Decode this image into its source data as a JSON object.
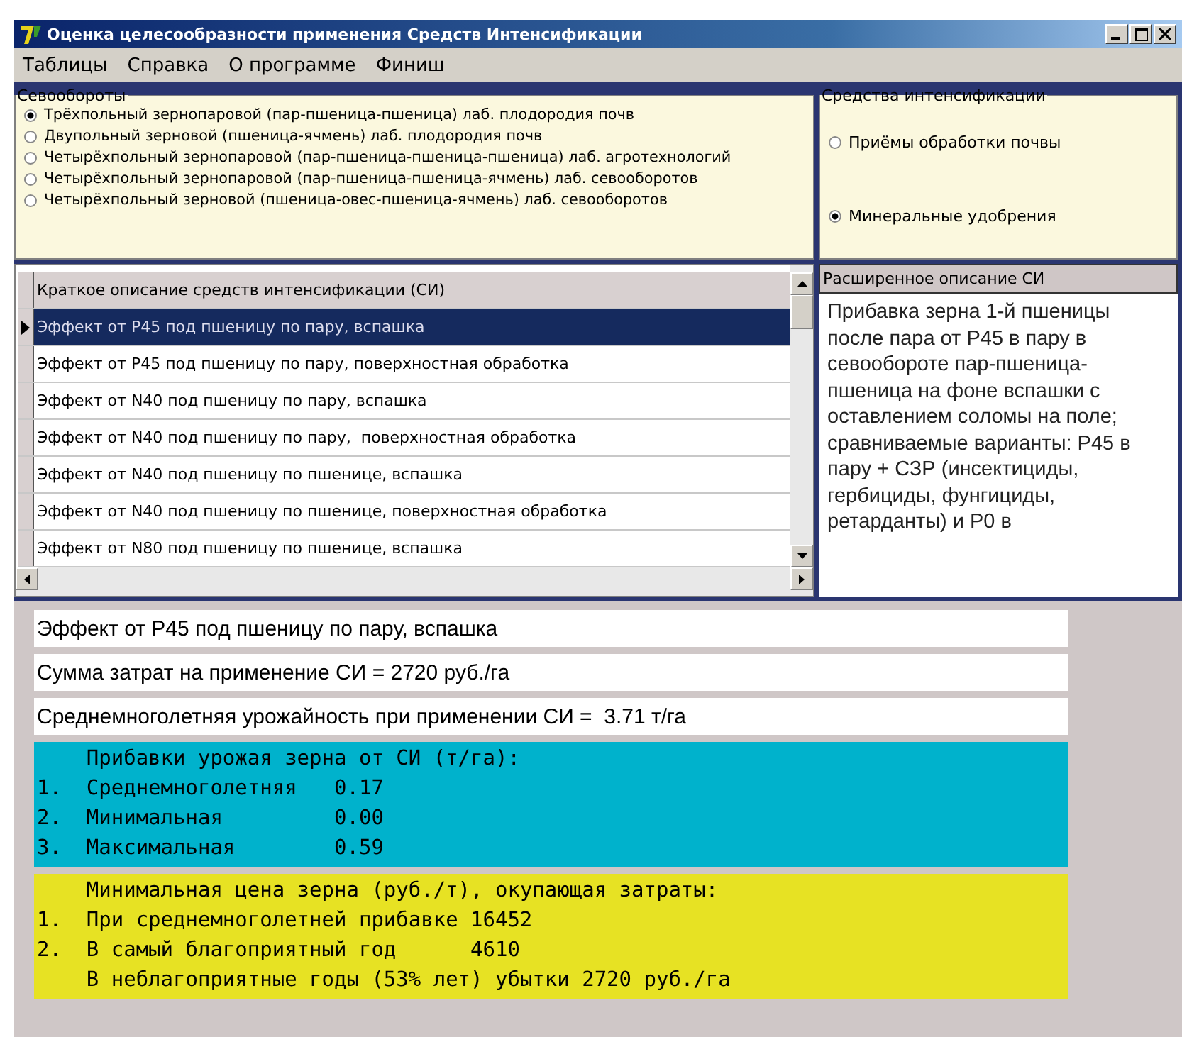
{
  "window": {
    "title": "Оценка целесообразности применения Средств Интенсификации"
  },
  "menu": [
    "Таблицы",
    "Справка",
    "О программе",
    "Финиш"
  ],
  "rotations": {
    "title": "Севообороты",
    "options": [
      {
        "label": "Трёхпольный зернопаровой (пар-пшеница-пшеница) лаб. плодородия почв",
        "selected": true
      },
      {
        "label": "Двупольный зерновой (пшеница-ячмень) лаб. плодородия почв",
        "selected": false
      },
      {
        "label": "Четырёхпольный зернопаровой (пар-пшеница-пшеница-пшеница) лаб. агротехнологий",
        "selected": false
      },
      {
        "label": "Четырёхпольный зернопаровой (пар-пшеница-пшеница-ячмень) лаб. севооборотов",
        "selected": false
      },
      {
        "label": "Четырёхпольный зерновой (пшеница-овес-пшеница-ячмень) лаб. севооборотов",
        "selected": false
      }
    ]
  },
  "means": {
    "title": "Средства интенсификации",
    "options": [
      {
        "label": "Приёмы обработки почвы",
        "selected": false
      },
      {
        "label": "Минеральные удобрения",
        "selected": true
      }
    ]
  },
  "table": {
    "columns": [
      "Краткое описание средств интенсификации (СИ)"
    ],
    "rows": [
      {
        "text": "Эффект от P45 под пшеницу по пару, вспашка",
        "selected": true
      },
      {
        "text": "Эффект от P45 под пшеницу по пару, поверхностная обработка",
        "selected": false
      },
      {
        "text": "Эффект от N40 под пшеницу по пару, вспашка",
        "selected": false
      },
      {
        "text": "Эффект от N40 под пшеницу по пару,  поверхностная обработка",
        "selected": false
      },
      {
        "text": "Эффект от N40 под пшеницу по пшенице, вспашка",
        "selected": false
      },
      {
        "text": "Эффект от N40 под пшеницу по пшенице, поверхностная обработка",
        "selected": false
      },
      {
        "text": "Эффект от N80 под пшеницу по пшенице, вспашка",
        "selected": false
      }
    ]
  },
  "description": {
    "title": "Расширенное описание СИ",
    "text": "Прибавка зерна 1-й пшеницы после пара от P45 в пару  в севообороте пар-пшеница-пшеница на фоне вспашки с оставлением соломы на поле;  сравниваемые варианты: P45 в пару +  СЗР (инсектициды, гербициды, фунгициды, ретарданты) и P0 в"
  },
  "summary": [
    "Эффект от P45 под пшеницу по пару, вспашка",
    "Сумма затрат на применение СИ = 2720 руб./га",
    "Среднемноголетняя урожайность при применении СИ =  3.71 т/га"
  ],
  "gains": {
    "title": "Прибавки урожая зерна от СИ (т/га):",
    "items": [
      {
        "num": "1.",
        "label": "Среднемноголетняя",
        "value": "0.17"
      },
      {
        "num": "2.",
        "label": "Минимальная",
        "value": "0.00"
      },
      {
        "num": "3.",
        "label": "Максимальная",
        "value": "0.59"
      }
    ]
  },
  "prices": {
    "title": "Минимальная цена зерна (руб./т), окупающая затраты:",
    "items": [
      {
        "num": "1.",
        "label": "При среднемноголетней прибавке",
        "value": "16452"
      },
      {
        "num": "2.",
        "label": "В самый благоприятный год",
        "value": "4610"
      },
      {
        "label": "В неблагоприятные годы (53% лет) убытки 2720 руб./га"
      }
    ]
  }
}
